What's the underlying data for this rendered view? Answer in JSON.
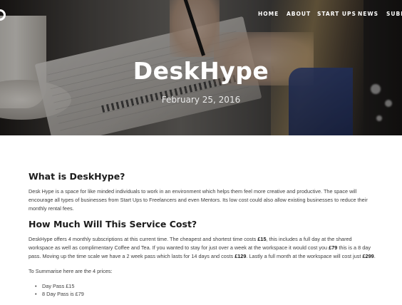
{
  "nav": {
    "items": [
      "HOME",
      "ABOUT",
      "START UPS",
      "NEWS",
      "SUBM"
    ]
  },
  "hero": {
    "title": "DeskHype",
    "date": "February 25, 2016"
  },
  "article": {
    "heading1": "What is DeskHype?",
    "para1": "Desk Hype is a space for like minded individuals to work in an environment which helps them feel more creative and productive.  The space will encourage all types of businesses from Start Ups to Freelancers and even Mentors. Its low cost could also allow existing businesses to reduce their monthly rental fees.",
    "heading2": "How Much Will This Service Cost?",
    "para2": {
      "t1": "DeskHype offers 4 monthly subscriptions at this current time. The cheapest and shortest time costs ",
      "b1": "£15",
      "t2": ", this includes a full day at the shared workspace as well as complimentary Coffee and Tea. If you wanted to stay for just over a week at the workspace it would cost you ",
      "b2": "£79",
      "t3": " this is a 8 day pass. Moving up the time scale we have a 2 week pass which lasts for 14 days and costs ",
      "b3": "£129",
      "t4": ". Lastly a full month at the workspace will cost just ",
      "b4": "£299",
      "t5": "."
    },
    "para3": "To Summarise here are the 4 prices:",
    "prices": [
      "Day Pass £15",
      "8 Day Pass is £79"
    ]
  },
  "colors": {
    "nav_text": "#ffffff",
    "heading": "#1c1c1c",
    "body_text": "#3d3d3d",
    "background": "#ffffff"
  },
  "icons": {
    "logo": "circle-logo-icon"
  }
}
